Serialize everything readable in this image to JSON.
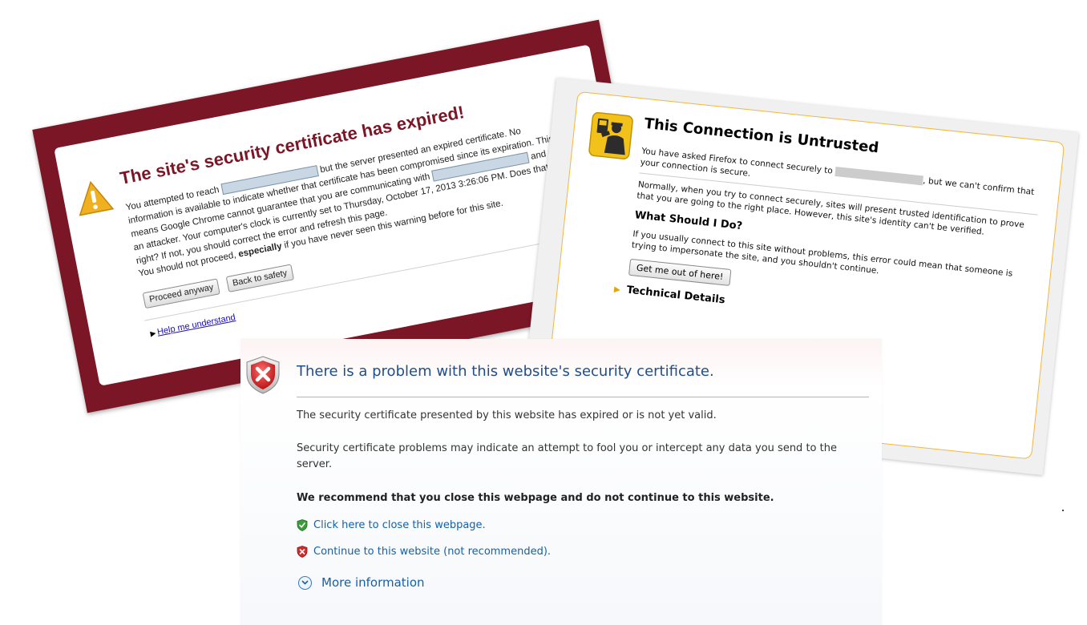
{
  "chrome": {
    "title": "The site's security certificate has expired!",
    "p1_a": "You attempted to reach",
    "p1_b": "but the server presented an expired certificate. No information is available to indicate whether that certificate has been compromised since its expiration. This means Google Chrome cannot guarantee that you are communicating with",
    "p1_c": "and not an attacker. Your computer's clock is currently set to Thursday, October 17, 2013 3:26:06 PM. Does that look right? If not, you should correct the error and refresh this page.",
    "p2": "You should not proceed,",
    "p2_strong": "especially",
    "p2_rest": "if you have never seen this warning before for this site.",
    "proceed_label": "Proceed anyway",
    "back_label": "Back to safety",
    "help_label": "Help me understand",
    "colors": {
      "frame": "#7b1626",
      "title": "#7b1626"
    },
    "icon": "warning-triangle-icon"
  },
  "firefox": {
    "title": "This Connection is Untrusted",
    "p1_a": "You have asked Firefox to connect securely to",
    "p1_b": ", but we can't confirm that your connection is secure.",
    "p2": "Normally, when you try to connect securely, sites will present trusted identification to prove that you are going to the right place. However, this site's identity can't be verified.",
    "h2": "What Should I Do?",
    "p3": "If you usually connect to this site without problems, this error could mean that someone is trying to impersonate the site, and you shouldn't continue.",
    "button_label": "Get me out of here!",
    "tech_label": "Technical Details",
    "icon": "police-officer-icon"
  },
  "ie": {
    "title": "There is a problem with this website's security certificate.",
    "text1": "The security certificate presented by this website has expired or is not yet valid.",
    "text2": "Security certificate problems may indicate an attempt to fool you or intercept any data you send to the server.",
    "text3": "We recommend that you close this webpage and do not continue to this website.",
    "close_link": "Click here to close this webpage.",
    "continue_link": "Continue to this website (not recommended).",
    "more_info": "More information",
    "colors": {
      "title": "#1f4e8c",
      "link": "#1560a6"
    },
    "icon": "red-shield-x-icon"
  }
}
